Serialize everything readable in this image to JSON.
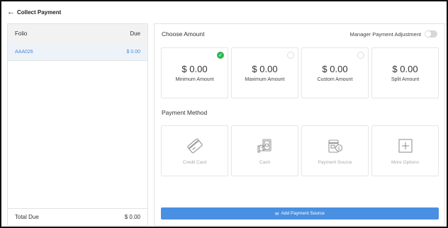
{
  "header": {
    "back_icon": "←",
    "title": "Collect Payment"
  },
  "folio_panel": {
    "col_folio": "Folio",
    "col_due": "Due",
    "rows": [
      {
        "folio": "AAA026",
        "due": "$ 0.00"
      }
    ],
    "total_label": "Total Due",
    "total_value": "$ 0.00"
  },
  "choose_amount": {
    "title": "Choose Amount",
    "manager_label": "Manager Payment Adjustment",
    "manager_toggle_on": false,
    "options": [
      {
        "value": "$ 0.00",
        "label": "Minimum Amount",
        "selected": true
      },
      {
        "value": "$ 0.00",
        "label": "Maximum Amount",
        "selected": false
      },
      {
        "value": "$ 0.00",
        "label": "Custom Amount",
        "selected": false
      },
      {
        "value": "$ 0.00",
        "label": "Split Amount",
        "selected": null
      }
    ]
  },
  "payment_method": {
    "title": "Payment Method",
    "methods": [
      {
        "label": "Credit Card",
        "icon": "credit-card-icon"
      },
      {
        "label": "Cash",
        "icon": "cash-icon"
      },
      {
        "label": "Payment Source",
        "icon": "payment-source-icon"
      },
      {
        "label": "More Options",
        "icon": "plus-box-icon"
      }
    ]
  },
  "add_button": {
    "icon": "✉",
    "label": "Add Payment Source"
  },
  "colors": {
    "accent": "#4a90e2",
    "selected": "#2eb855",
    "folio_link": "#4a8ad6"
  }
}
